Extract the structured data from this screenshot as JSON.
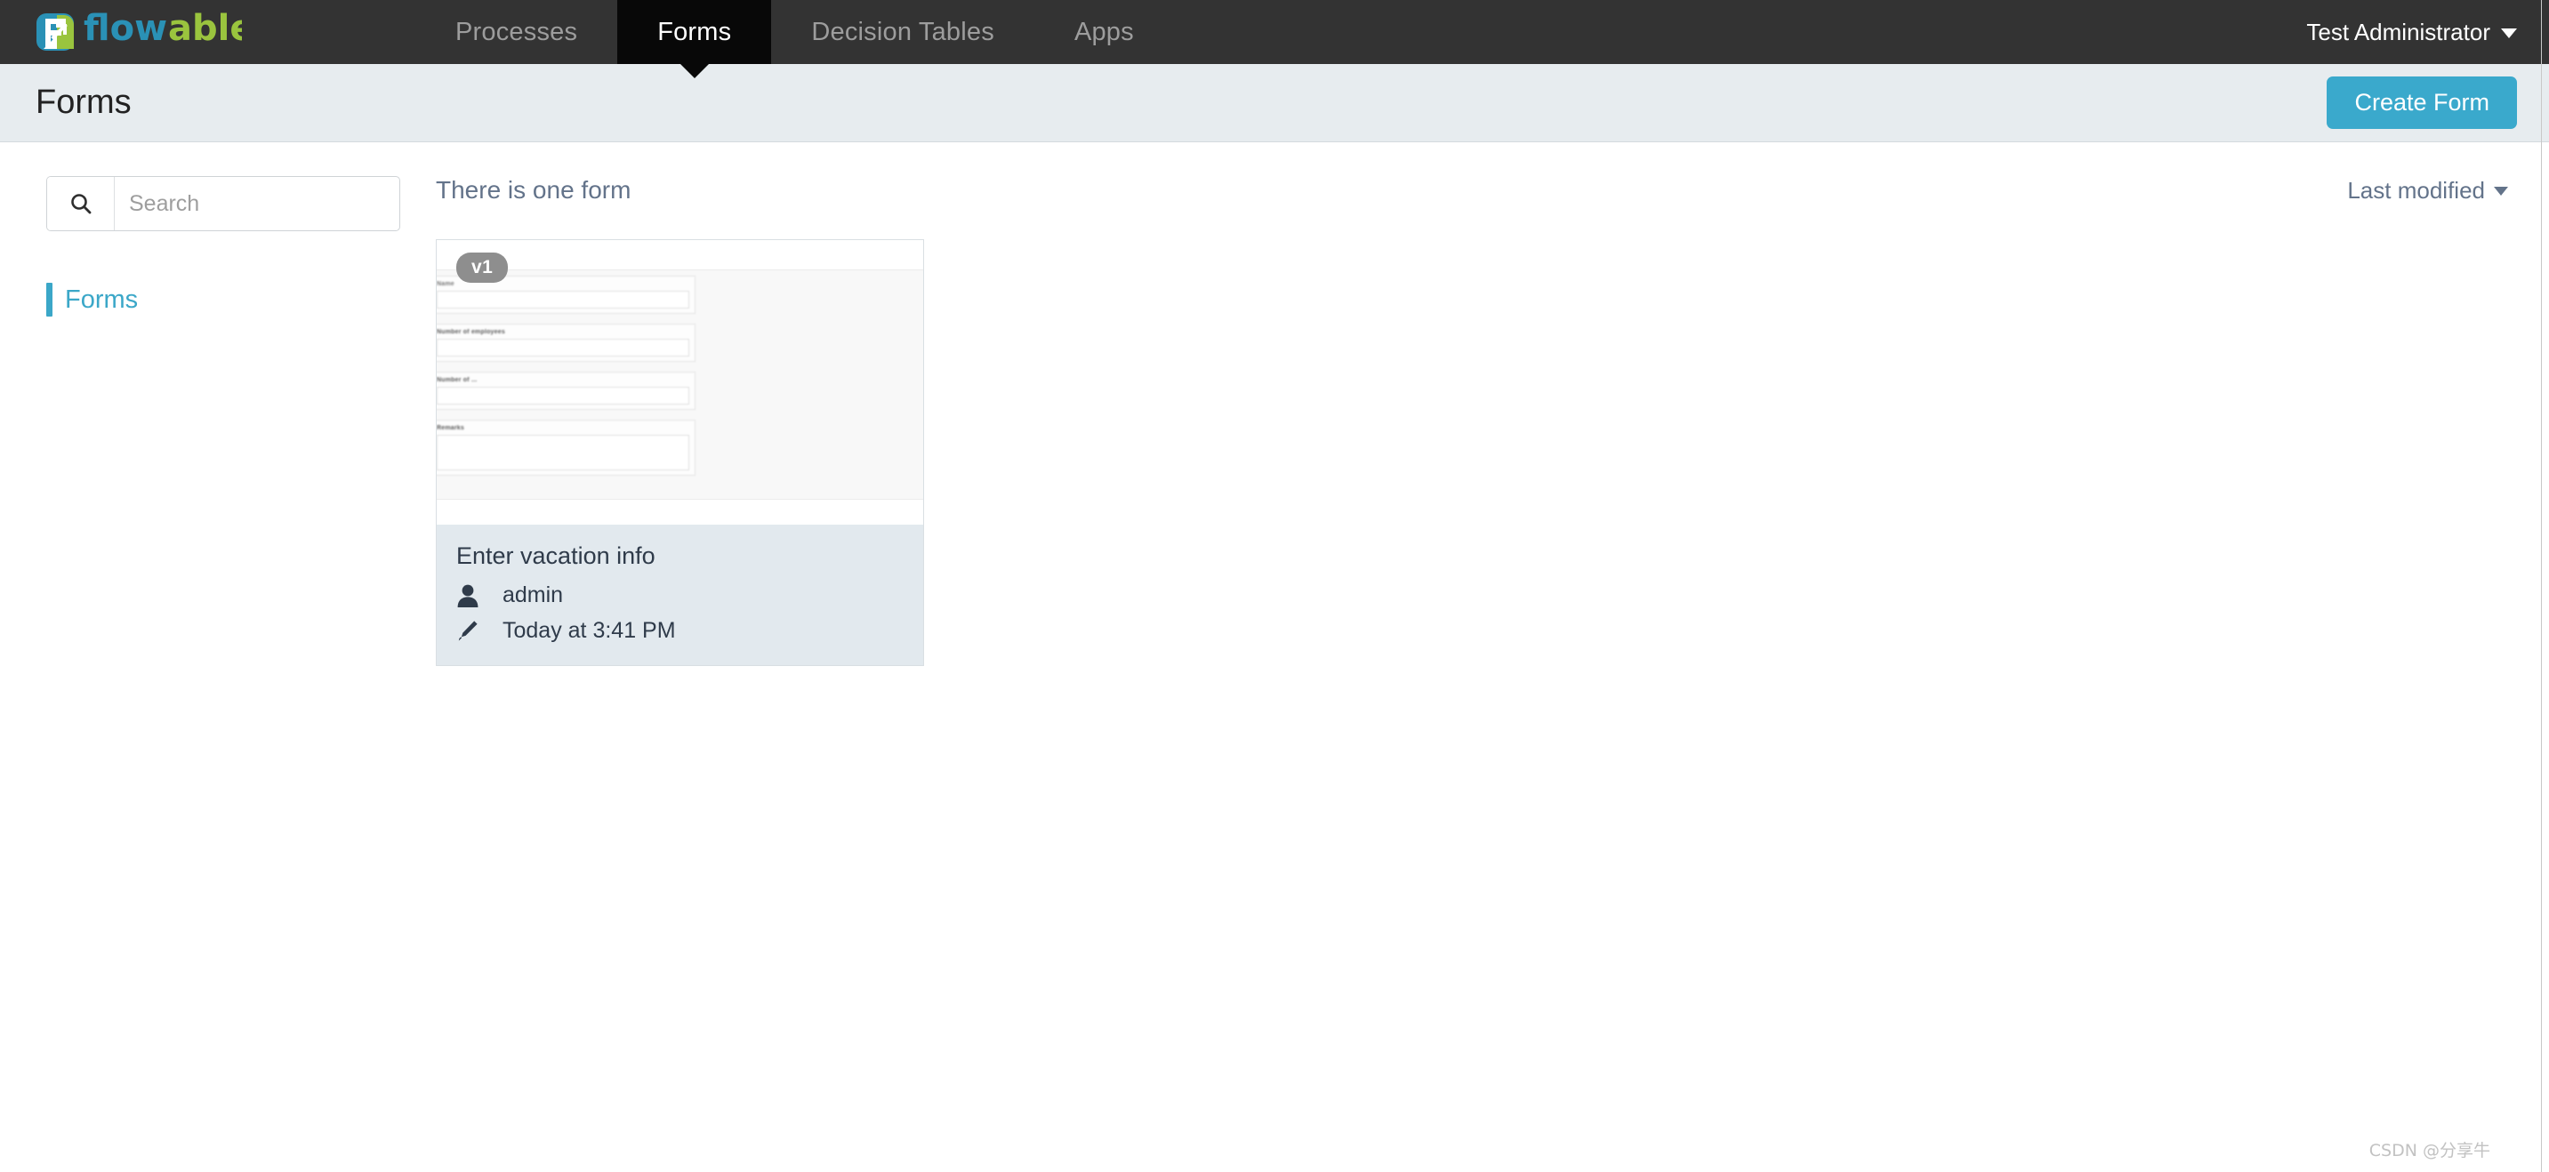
{
  "app": {
    "brand_name": "flowable",
    "brand_colors": {
      "blue": "#2a91b6",
      "green": "#9ac43e",
      "dark_nav": "#333333",
      "accent": "#3aa9cc"
    }
  },
  "topnav": {
    "tabs": [
      {
        "label": "Processes",
        "active": false
      },
      {
        "label": "Forms",
        "active": true
      },
      {
        "label": "Decision Tables",
        "active": false
      },
      {
        "label": "Apps",
        "active": false
      }
    ],
    "user": {
      "name": "Test Administrator",
      "caret": "chevron-down-icon"
    }
  },
  "titlebar": {
    "title": "Forms",
    "create_button": "Create Form"
  },
  "sidebar": {
    "search": {
      "placeholder": "Search",
      "value": "",
      "icon": "search-icon"
    },
    "items": [
      {
        "label": "Forms",
        "active": true
      }
    ]
  },
  "main": {
    "count_text": "There is one form",
    "sort": {
      "label": "Last modified",
      "icon": "caret-down-icon"
    },
    "cards": [
      {
        "version": "v1",
        "title": "Enter vacation info",
        "author": "admin",
        "author_icon": "user-icon",
        "modified": "Today at 3:41 PM",
        "modified_icon": "pencil-icon",
        "preview_fields": [
          {
            "label": "Name",
            "type": "input"
          },
          {
            "label": "Number of employees",
            "type": "input"
          },
          {
            "label": "Number of ...",
            "type": "input"
          },
          {
            "label": "Remarks",
            "type": "textarea"
          }
        ]
      }
    ]
  },
  "watermark": "CSDN @分享牛"
}
